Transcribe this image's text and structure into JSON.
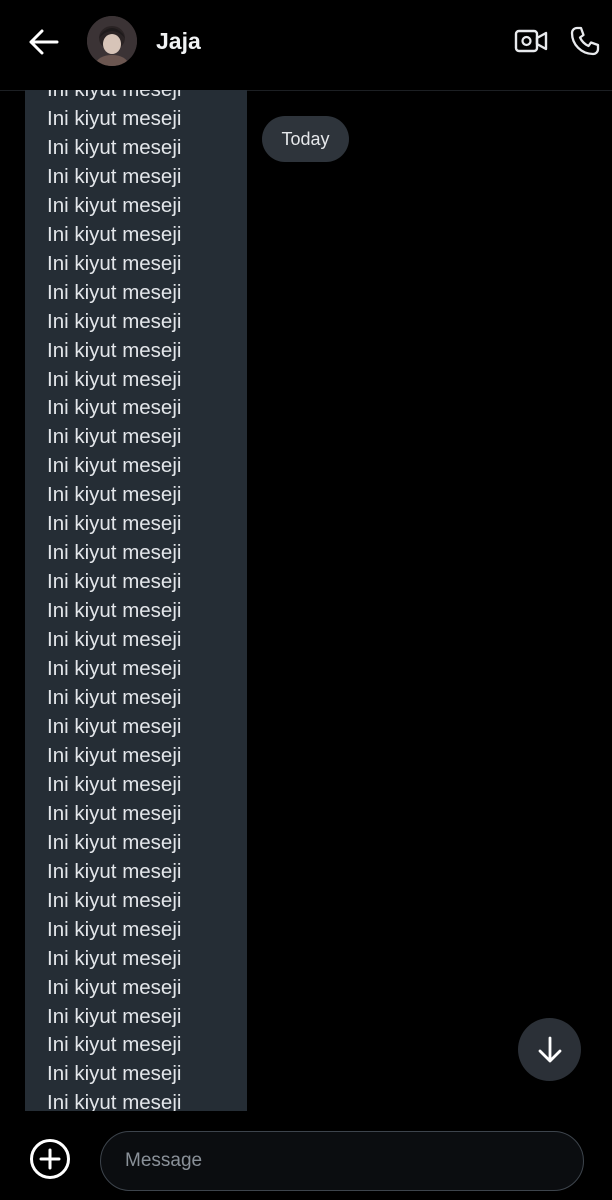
{
  "header": {
    "contact_name": "Jaja"
  },
  "conversation": {
    "date_chip": "Today",
    "message_line_text": "Ini kiyut meseji",
    "visible_line_count": 36
  },
  "composer": {
    "placeholder": "Message"
  },
  "icons": {
    "back": "arrow-left-icon",
    "video_call": "video-camera-icon",
    "voice_call": "phone-icon",
    "scroll_down": "arrow-down-icon",
    "attach": "plus-circle-icon"
  },
  "colors": {
    "background": "#000000",
    "bubble": "#252d35",
    "chip": "#2e343b",
    "scroll_button": "#2b3037",
    "text": "#e3e6ea",
    "icon": "#e8eaed"
  }
}
